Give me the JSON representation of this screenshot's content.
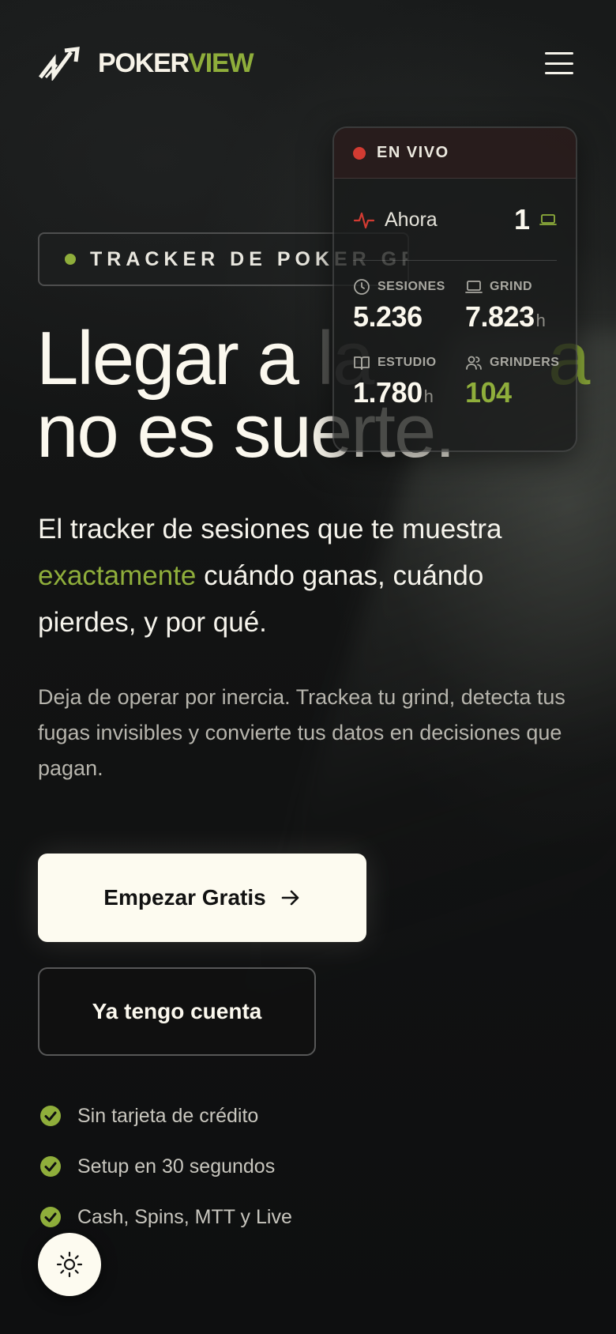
{
  "header": {
    "brand_part1": "POKER",
    "brand_part2": "VIEW",
    "logo_icon": "chart-zigzag-icon",
    "menu_icon": "hamburger-icon"
  },
  "badge": {
    "text": "TRACKER DE POKER GR"
  },
  "hero": {
    "headline_line1_start": "Llegar a ",
    "headline_line1_faded": "la",
    "headline_line1_accent": "a",
    "headline_line2": "no es suerte.",
    "subtitle_start": "El tracker de sesiones que te muestra ",
    "subtitle_accent": "exactamente",
    "subtitle_end": " cuándo ganas, cuándo pierdes, y por qué.",
    "description": "Deja de operar por inercia. Trackea tu grind, detecta tus fugas invisibles y convierte tus datos en decisiones que pagan."
  },
  "live_card": {
    "status": "EN VIVO",
    "now_label": "Ahora",
    "now_value": "1",
    "stats": [
      {
        "label": "SESIONES",
        "value": "5.236",
        "unit": "",
        "icon": "clock-icon"
      },
      {
        "label": "GRIND",
        "value": "7.823",
        "unit": "h",
        "icon": "laptop-icon"
      },
      {
        "label": "ESTUDIO",
        "value": "1.780",
        "unit": "h",
        "icon": "book-icon"
      },
      {
        "label": "GRINDERS",
        "value": "104",
        "unit": "",
        "icon": "users-icon"
      }
    ]
  },
  "actions": {
    "primary_label": "Empezar Gratis",
    "secondary_label": "Ya tengo cuenta"
  },
  "features": [
    "Sin tarjeta de crédito",
    "Setup en 30 segundos",
    "Cash, Spins, MTT y Live"
  ],
  "colors": {
    "accent": "#8fae3b",
    "live_red": "#d23b32",
    "background": "#0f1011",
    "cream": "#fdfbf0"
  }
}
